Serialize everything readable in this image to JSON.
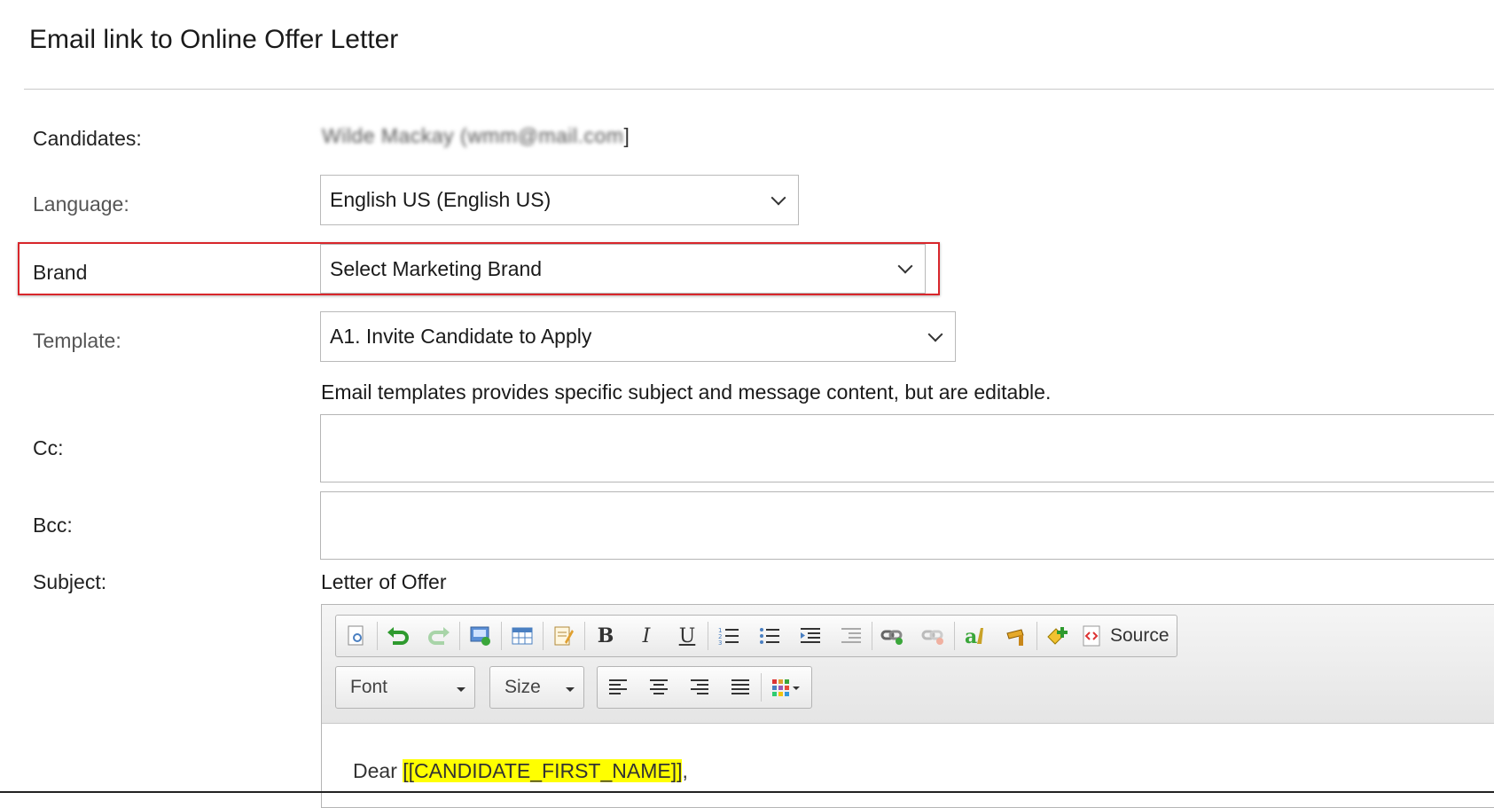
{
  "dialog": {
    "title": "Email link to Online Offer Letter"
  },
  "form": {
    "candidates": {
      "label": "Candidates:",
      "value": "Wilde Mackay (wmm@mail.com",
      "suffix": "]"
    },
    "language": {
      "label": "Language:",
      "value": "English US (English US)"
    },
    "brand": {
      "label": "Brand",
      "value": "Select Marketing Brand"
    },
    "template": {
      "label": "Template:",
      "value": "A1. Invite Candidate to Apply",
      "hint": "Email templates provides specific subject and message content, but are editable."
    },
    "cc": {
      "label": "Cc:",
      "value": ""
    },
    "bcc": {
      "label": "Bcc:",
      "value": ""
    },
    "subject": {
      "label": "Subject:",
      "value": "Letter of Offer"
    }
  },
  "editor": {
    "toolbar": {
      "source_label": "Source",
      "font_label": "Font",
      "size_label": "Size",
      "icons": [
        "preview-icon",
        "undo-icon",
        "redo-icon",
        "image-icon",
        "table-icon",
        "template-icon",
        "bold-icon",
        "italic-icon",
        "underline-icon",
        "numbered-list-icon",
        "bulleted-list-icon",
        "indent-icon",
        "outdent-icon",
        "link-icon",
        "unlink-icon",
        "spellcheck-icon",
        "insert-field-icon",
        "add-field-icon",
        "source-icon",
        "align-left-icon",
        "align-center-icon",
        "align-right-icon",
        "justify-icon",
        "color-grid-icon"
      ]
    },
    "body": {
      "greeting": "Dear ",
      "merge_field": "[[CANDIDATE_FIRST_NAME]]",
      "punct": ","
    }
  },
  "colors": {
    "highlight_border": "#d8262b",
    "merge_field_bg": "#ffff00"
  }
}
